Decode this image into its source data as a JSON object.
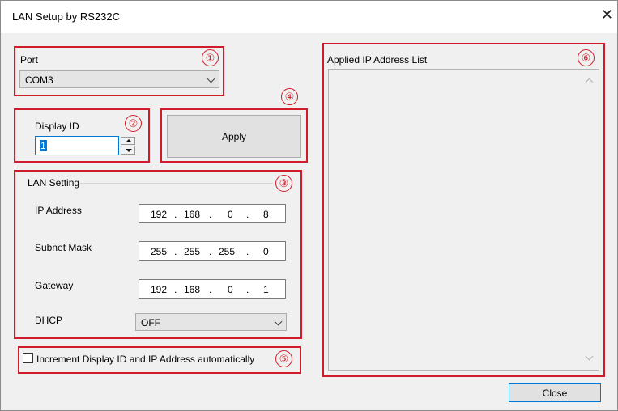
{
  "window": {
    "title": "LAN Setup by RS232C",
    "close_glyph": "✕"
  },
  "callouts": {
    "one": "①",
    "two": "②",
    "three": "③",
    "four": "④",
    "five": "⑤",
    "six": "⑥"
  },
  "port": {
    "label": "Port",
    "selected": "COM3"
  },
  "display_id": {
    "label": "Display ID",
    "value": "1"
  },
  "apply_button": {
    "label": "Apply"
  },
  "lan_setting": {
    "group_label": "LAN Setting",
    "ip_address": {
      "label": "IP Address",
      "octets": [
        "192",
        "168",
        "0",
        "8"
      ]
    },
    "subnet_mask": {
      "label": "Subnet Mask",
      "octets": [
        "255",
        "255",
        "255",
        "0"
      ]
    },
    "gateway": {
      "label": "Gateway",
      "octets": [
        "192",
        "168",
        "0",
        "1"
      ]
    },
    "dhcp": {
      "label": "DHCP",
      "selected": "OFF"
    }
  },
  "auto_increment": {
    "label": "Increment Display ID and IP Address automatically",
    "checked": false
  },
  "applied_list": {
    "label": "Applied IP Address List",
    "items": []
  },
  "close_button": {
    "label": "Close"
  }
}
